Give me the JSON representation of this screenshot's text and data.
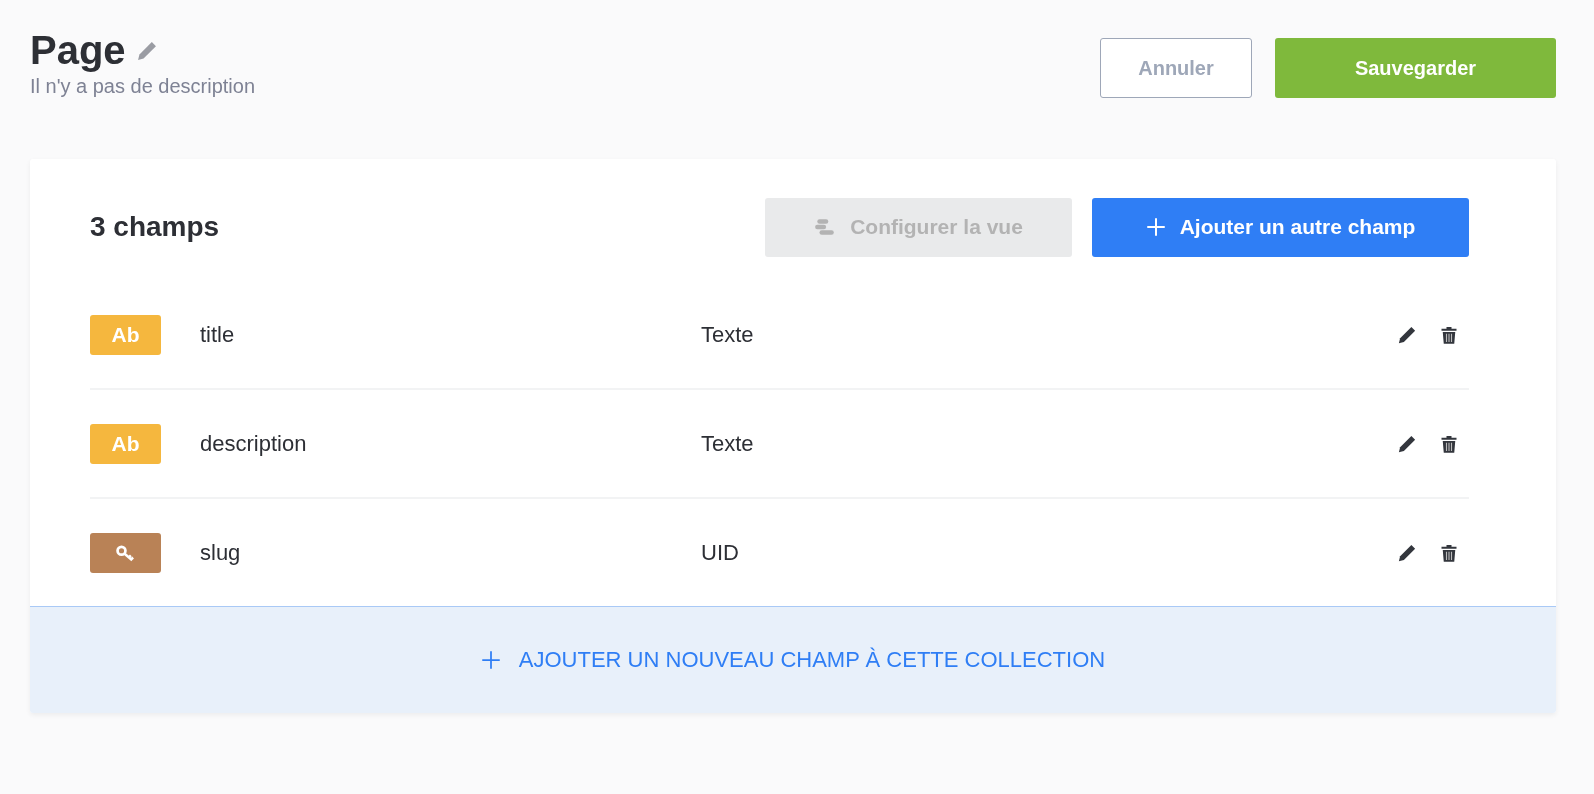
{
  "header": {
    "title": "Page",
    "description": "Il n'y a pas de description"
  },
  "actions": {
    "cancel": "Annuler",
    "save": "Sauvegarder"
  },
  "card": {
    "count": "3 champs",
    "configure": {
      "label": "Configurer la vue",
      "disabled": true
    },
    "add_field": "Ajouter un autre champ",
    "fields": [
      {
        "kind": "text",
        "badge": "Ab",
        "name": "title",
        "type": "Texte"
      },
      {
        "kind": "text",
        "badge": "Ab",
        "name": "description",
        "type": "Texte"
      },
      {
        "kind": "uid",
        "name": "slug",
        "type": "UID"
      }
    ],
    "footer": "AJOUTER UN NOUVEAU CHAMP À CETTE COLLECTION"
  }
}
